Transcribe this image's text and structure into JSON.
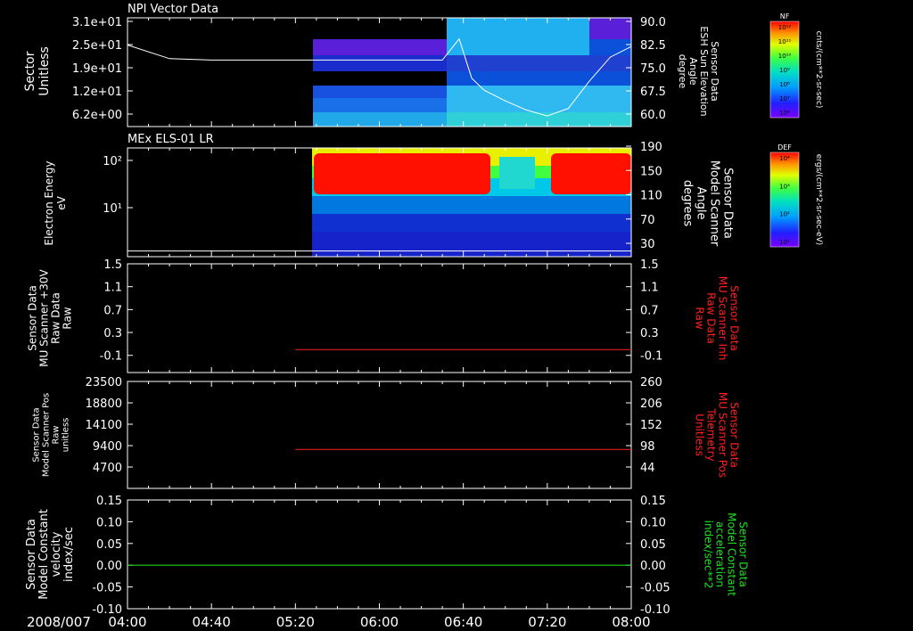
{
  "colors": {
    "white": "#ffffff",
    "red_trace": "#e02020",
    "green_trace": "#20d020",
    "red_label": "#ff2020",
    "green_label": "#20e020"
  },
  "time_axis": {
    "date_label": "2008/007",
    "ticks": [
      "04:00",
      "04:40",
      "05:20",
      "06:00",
      "06:40",
      "07:20",
      "08:00"
    ]
  },
  "colorbars": [
    {
      "badge": "NF",
      "unit": "cnts/(cm**2-sr-sec)",
      "tick_labels": [
        "10¹²",
        "10¹¹",
        "10¹⁰",
        "10⁹",
        "10⁸",
        "10⁷",
        "10⁶"
      ]
    },
    {
      "badge": "DEF",
      "unit": "ergs/(cm**2-sr-sec-eV)",
      "tick_labels": [
        "10⁴",
        "10³",
        "10²",
        "10¹"
      ]
    }
  ],
  "chart_data": [
    {
      "type": "heatmap",
      "title": "NPI Vector Data",
      "ylabel": [
        "Sector",
        "Unitless"
      ],
      "yticks": [
        "3.1e+01",
        "2.5e+01",
        "1.9e+01",
        "1.2e+01",
        "6.2e+00"
      ],
      "y2label": [
        "Sensor Data",
        "ESH Sun Elevation",
        "Angle",
        "degree"
      ],
      "y2ticks": [
        "90.0",
        "82.5",
        "75.0",
        "67.5",
        "60.0"
      ],
      "y2lim": [
        54,
        90
      ],
      "data_start": "05:24",
      "overlay_line": {
        "axis": "right",
        "x": [
          "04:00",
          "04:20",
          "04:40",
          "05:00",
          "05:20",
          "06:00",
          "06:30",
          "06:38",
          "06:44",
          "06:50",
          "07:00",
          "07:10",
          "07:20",
          "07:30",
          "07:40",
          "07:50",
          "08:00"
        ],
        "y": [
          81.0,
          76.5,
          76.0,
          76.0,
          76.0,
          76.0,
          76.0,
          83.0,
          70.0,
          66.0,
          62.5,
          59.5,
          57.5,
          60.0,
          69.0,
          77.0,
          80.5
        ]
      }
    },
    {
      "type": "heatmap",
      "title": "MEx ELS-01 LR",
      "ylabel": [
        "Electron Energy",
        "eV"
      ],
      "yticks": [
        "10²",
        "10¹"
      ],
      "ylog": true,
      "y2label": [
        "Sensor Data",
        "Model Scanner",
        "Angle",
        "degrees"
      ],
      "y2ticks": [
        "190",
        "150",
        "110",
        "70",
        "30"
      ],
      "y2lim": [
        0,
        190
      ],
      "data_start": "05:24",
      "overlay_line": {
        "axis": "right",
        "x": [
          "04:00",
          "08:00"
        ],
        "y": [
          10,
          10
        ]
      }
    },
    {
      "type": "line",
      "ylabel": [
        "Sensor Data",
        "MU Scanner +30V",
        "Raw Data",
        "Raw"
      ],
      "yticks": [
        "1.5",
        "1.1",
        "0.7",
        "0.3",
        "-0.1"
      ],
      "ylim": [
        -0.4,
        1.5
      ],
      "y2label": [
        "Sensor Data",
        "MU Scanner Inh",
        "Raw Data",
        "Raw"
      ],
      "y2ticks": [
        "1.5",
        "1.1",
        "0.7",
        "0.3",
        "-0.1"
      ],
      "series": [
        {
          "axis": "left",
          "x": [
            "05:20",
            "08:00"
          ],
          "y": [
            0.0,
            0.0
          ]
        }
      ]
    },
    {
      "type": "line",
      "ylabel": [
        "Sensor Data",
        "Model Scanner Pos",
        "Raw",
        "unitless"
      ],
      "yticks": [
        "23500",
        "18800",
        "14100",
        "9400",
        "4700"
      ],
      "ylim": [
        0,
        23500
      ],
      "y2label": [
        "Sensor Data",
        "MU Scanner Pos",
        "Telemetry",
        "Unitless"
      ],
      "y2ticks": [
        "260",
        "206",
        "152",
        "98",
        "44"
      ],
      "series": [
        {
          "axis": "left",
          "x": [
            "05:20",
            "08:00"
          ],
          "y": [
            8550,
            8550
          ]
        }
      ]
    },
    {
      "type": "line",
      "ylabel": [
        "Sensor Data",
        "Model Constant",
        "velocity",
        "index/sec"
      ],
      "yticks": [
        "0.15",
        "0.10",
        "0.05",
        "0.00",
        "-0.05",
        "-0.10"
      ],
      "ylim": [
        -0.1,
        0.15
      ],
      "y2label": [
        "Sensor Data",
        "Model Constant",
        "acceleration",
        "index/sec**2"
      ],
      "y2ticks": [
        "0.15",
        "0.10",
        "0.05",
        "0.00",
        "-0.05",
        "-0.10"
      ],
      "series": [
        {
          "axis": "left",
          "x": [
            "04:00",
            "08:00"
          ],
          "y": [
            0.0,
            0.0
          ]
        }
      ]
    }
  ]
}
